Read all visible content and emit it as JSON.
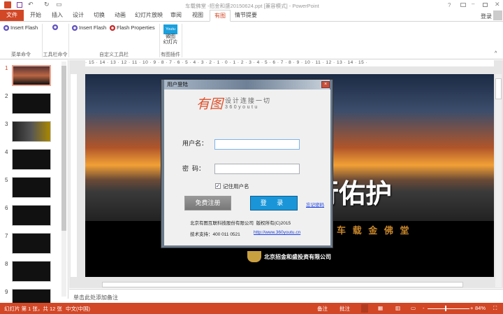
{
  "window": {
    "title": "车载佛堂 -招金和盛20150624.ppt [兼容模式] - PowerPoint",
    "help": "?",
    "signin": "登录"
  },
  "tabs": [
    "文件",
    "开始",
    "插入",
    "设计",
    "切换",
    "动画",
    "幻灯片放映",
    "审阅",
    "视图",
    "有图",
    "情节提要"
  ],
  "active_tab": "有图",
  "ribbon": {
    "groups": [
      {
        "label": "菜单命令",
        "buttons": [
          "Insert Flash"
        ]
      },
      {
        "label": "工具栏命令",
        "buttons": []
      },
      {
        "label": "自定义工具栏",
        "buttons": [
          "Insert Flash",
          "Flash Properties"
        ]
      },
      {
        "label": "有图插件",
        "buttons": [
          "微图\n幻灯片"
        ],
        "logo": "Youtu"
      }
    ]
  },
  "ruler": "· 15 · 14 · 13 · 12 · 11 · 10 · 9 · 8 · 7 · 6 · 5 · 4 · 3 · 2 · 1 · 0 · 1 · 2 · 3 · 4 · 5 · 6 · 7 · 8 · 9 · 10 · 11 · 12 · 13 · 14 · 15 ·",
  "slides": [
    "1",
    "2",
    "3",
    "4",
    "5",
    "6",
    "7",
    "8",
    "9"
  ],
  "slide": {
    "headline": "行佑护",
    "subline": "车 载 金 佛 堂",
    "company_logo": "北京招金和盛投资有限公司"
  },
  "dialog": {
    "title": "用户登陆",
    "logo_cn": "有图",
    "slogan": "设计连接一切",
    "logo_en": "360youtu",
    "username_label": "用户名：",
    "username_value": "",
    "password_label": "密  码：",
    "password_value": "",
    "remember_label": "记住用户名",
    "remember_checked": true,
    "register": "免费注册",
    "login": "登 录",
    "forgot": "忘记密码",
    "copyright": "北京有图互联科技股份有限公司  版权所有(C)2015",
    "support": "技术支持：400 011 0521",
    "url": "http://www.360youtu.cn"
  },
  "notes_placeholder": "单击此处添加备注",
  "status": {
    "slide_info": "幻灯片 第 1 张，共 12 张",
    "language": "中文(中国)",
    "notes": "备注",
    "comments": "批注",
    "zoom": "84%"
  }
}
